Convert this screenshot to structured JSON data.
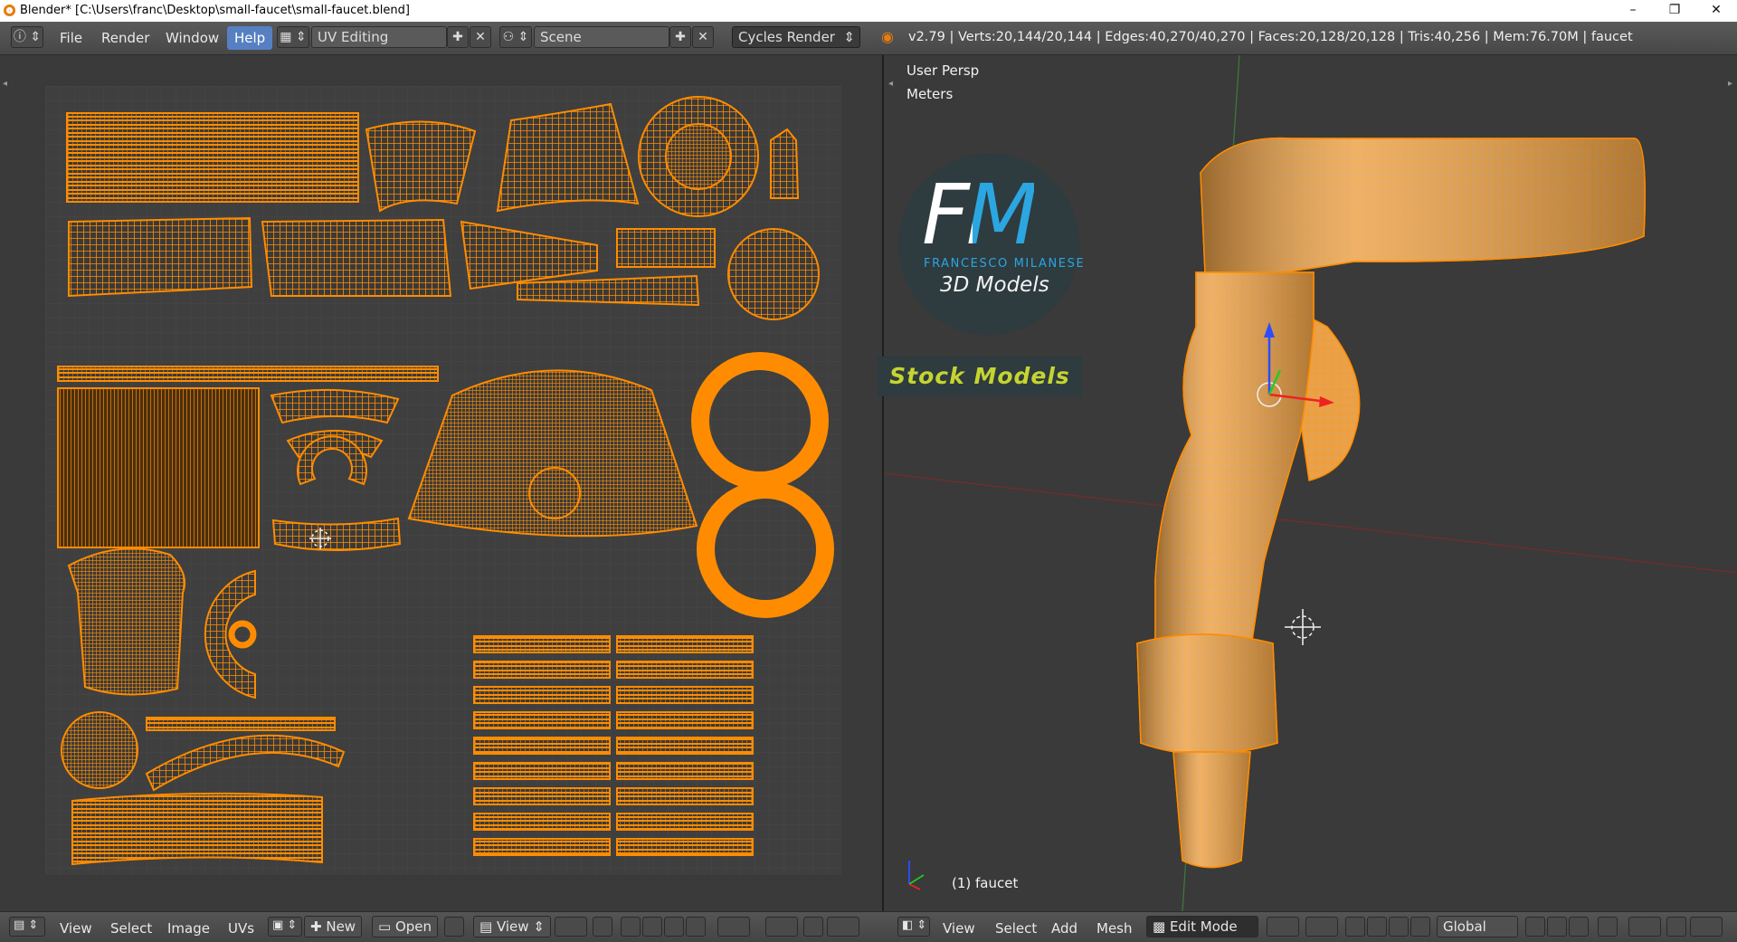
{
  "window": {
    "title": "Blender* [C:\\Users\\franc\\Desktop\\small-faucet\\small-faucet.blend]",
    "controls": [
      "–",
      "❐",
      "✕"
    ]
  },
  "header": {
    "menus": [
      "File",
      "Render",
      "Window",
      "Help"
    ],
    "screen_layout": "UV Editing",
    "scene": "Scene",
    "render_engine": "Cycles Render",
    "stats": "v2.79 | Verts:20,144/20,144 | Edges:40,270/40,270 | Faces:20,128/20,128 | Tris:40,256 | Mem:76.70M | faucet"
  },
  "uv_editor": {
    "footer_menus": [
      "View",
      "Select",
      "Image",
      "UVs"
    ],
    "new_label": "New",
    "open_label": "Open",
    "view_label": "View"
  },
  "viewport": {
    "view_name": "User Persp",
    "units": "Meters",
    "object_label": "(1) faucet",
    "footer_menus": [
      "View",
      "Select",
      "Add",
      "Mesh"
    ],
    "mode": "Edit Mode",
    "orientation": "Global"
  },
  "watermark": {
    "monogram": "FM",
    "author": "FRANCESCO MILANESE",
    "tagline": "3D Models",
    "badge": "Stock Models"
  },
  "colors": {
    "uv_wire": "#ff8c00",
    "selection": "#ffa030",
    "accent_blue": "#5680c2",
    "logo_blue": "#2ba6e0",
    "badge_text": "#c5d430"
  }
}
